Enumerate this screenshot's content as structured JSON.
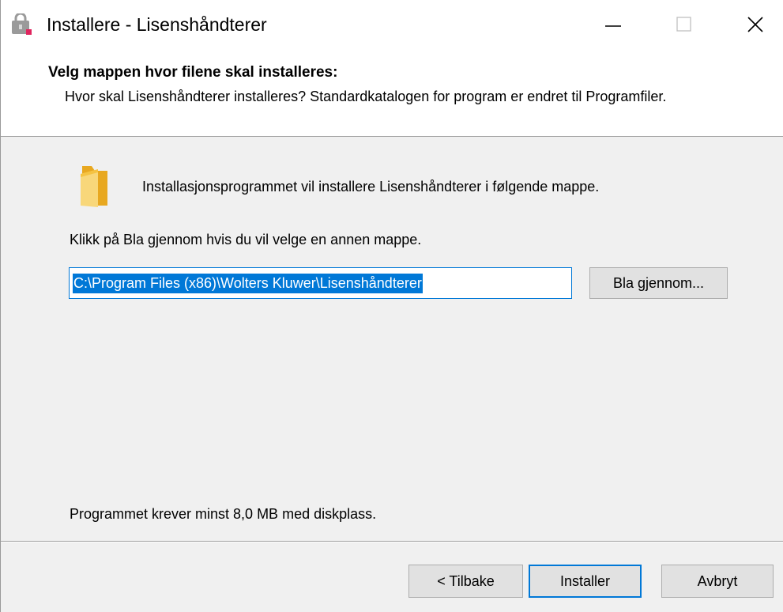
{
  "window": {
    "title": "Installere - Lisenshåndterer",
    "controls": {
      "minimize_icon": "minimize-icon",
      "maximize_icon": "maximize-icon",
      "close_icon": "close-icon"
    }
  },
  "header": {
    "title": "Velg mappen hvor filene skal installeres:",
    "description": "Hvor skal Lisenshåndterer installeres? Standardkatalogen for program er endret til Programfiler."
  },
  "body": {
    "intro": "Installasjonsprogrammet vil installere Lisenshåndterer i følgende mappe.",
    "hint": "Klikk på Bla gjennom hvis du vil velge en annen mappe.",
    "path_value": "C:\\Program Files (x86)\\Wolters Kluwer\\Lisenshåndterer",
    "browse_label": "Bla gjennom...",
    "disk_space": "Programmet krever minst 8,0 MB med diskplass."
  },
  "footer": {
    "back_label": "< Tilbake",
    "install_label": "Installer",
    "cancel_label": "Avbryt"
  },
  "colors": {
    "accent": "#0078d7",
    "folder": "#f5c342",
    "icon_badge": "#e0245e"
  }
}
